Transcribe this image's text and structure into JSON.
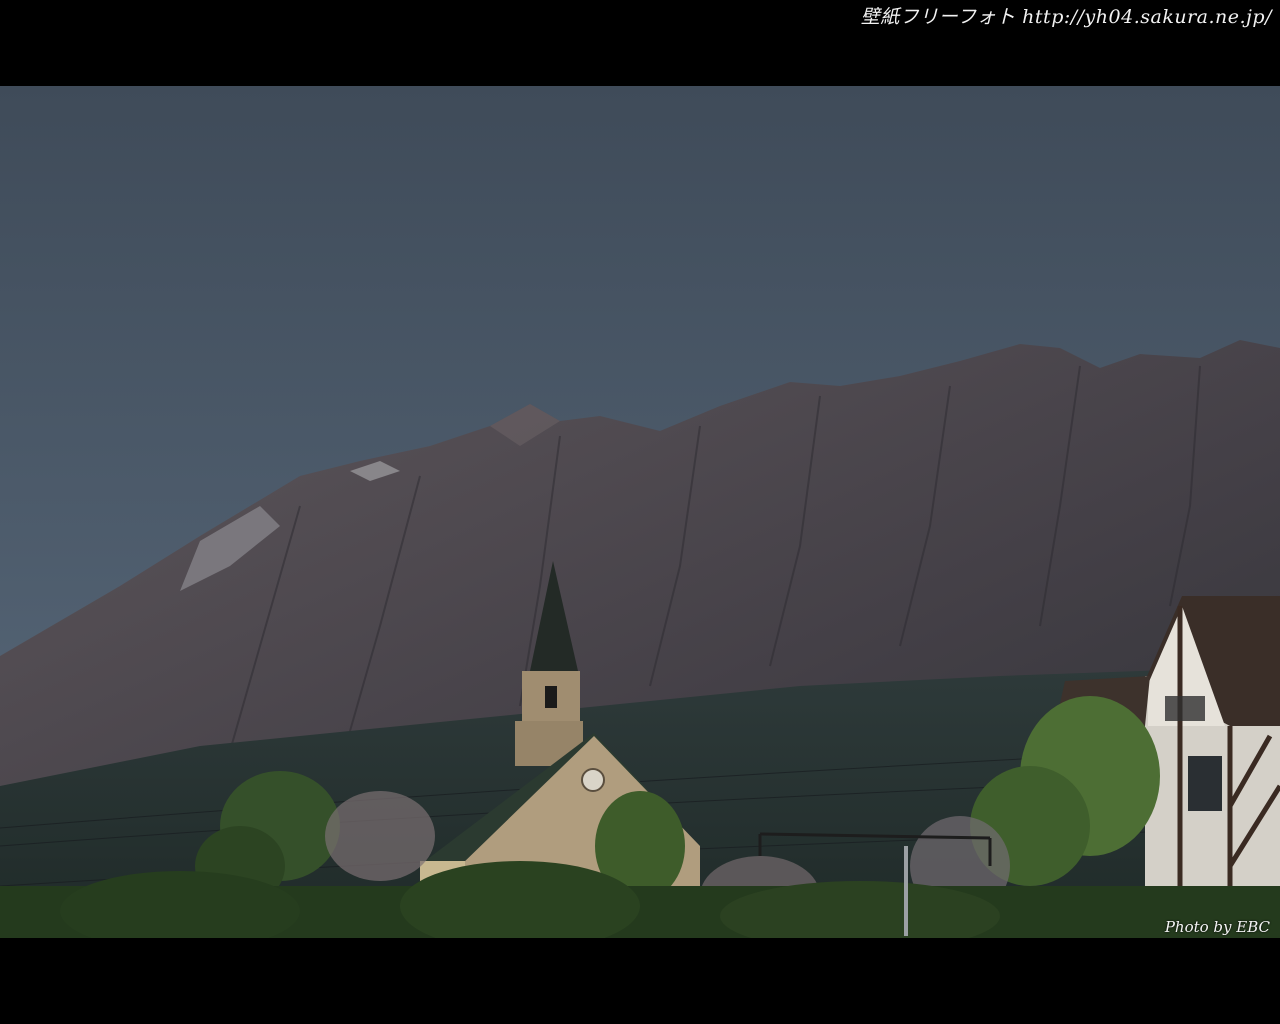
{
  "watermark": {
    "site_text": "壁紙フリーフォト http://yh04.sakura.ne.jp/",
    "photo_credit": "Photo by EBC"
  },
  "scene": {
    "subjects": [
      "volcano",
      "church-steeple",
      "half-timbered-house",
      "trees",
      "power-lines"
    ]
  },
  "colors": {
    "sky_top": "#414d5c",
    "sky_bottom": "#55677a",
    "mountain_dark": "#3a3a42",
    "mountain_light": "#5d565a",
    "church_wall": "#a89678",
    "church_roof": "#2c3b30",
    "tree_green": "#3d5a2c"
  }
}
